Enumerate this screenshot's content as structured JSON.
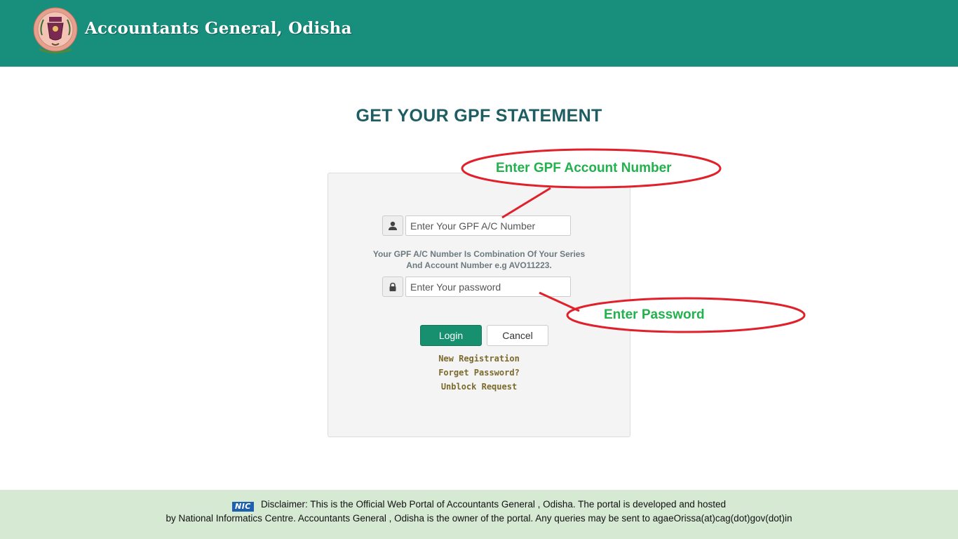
{
  "header": {
    "site_title": "Accountants General, Odisha",
    "emblem_icon": "emblem-seal-icon",
    "background_color": "#178f7c"
  },
  "main": {
    "page_title": "GET YOUR GPF STATEMENT",
    "form": {
      "account_field": {
        "icon": "user-icon",
        "placeholder": "Enter Your GPF A/C Number",
        "value": ""
      },
      "hint_line1": "Your GPF A/C Number Is Combination Of Your Series",
      "hint_line2": "And Account Number e.g AVO11223.",
      "password_field": {
        "icon": "lock-icon",
        "placeholder": "Enter Your password",
        "value": ""
      },
      "login_label": "Login",
      "cancel_label": "Cancel",
      "links": {
        "new_registration": "New Registration",
        "forget_password": "Forget Password?",
        "unblock_request": "Unblock Request"
      }
    }
  },
  "annotations": {
    "account_callout": "Enter GPF Account Number",
    "password_callout": "Enter Password",
    "ellipse_color": "#e0202a",
    "text_color": "#22b14c"
  },
  "footer": {
    "nic_logo": "NIC",
    "line1": "Disclaimer: This is the Official Web Portal of Accountants General , Odisha. The portal is developed and hosted",
    "line2": "by National Informatics Centre. Accountants General , Odisha is the owner of the portal. Any queries may be sent to agaeOrissa(at)cag(dot)gov(dot)in"
  }
}
